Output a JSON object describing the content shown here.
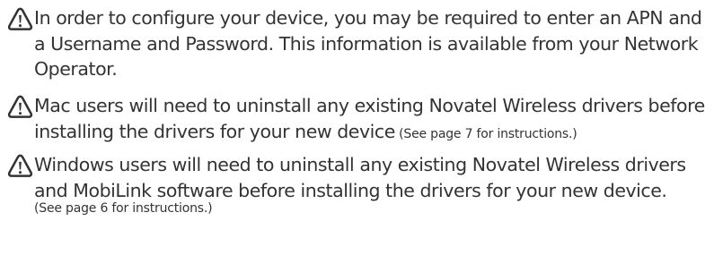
{
  "icon": {
    "name": "warning-icon",
    "color": "#333333"
  },
  "notices": [
    {
      "lines": [
        "In order to configure your device, you may be required to enter an APN and",
        "a Username and Password. This information is available from your Network",
        "Operator."
      ]
    },
    {
      "lines": [
        "Mac users will need to uninstall any existing Novatel Wireless drivers before",
        "installing the drivers for your new device"
      ],
      "note": " (See page 7 for instructions.)"
    },
    {
      "lines": [
        "Windows users will need to uninstall any existing Novatel Wireless drivers",
        "and MobiLink software before installing the drivers for your new device."
      ],
      "note": "(See page 6 for instructions.)"
    }
  ]
}
